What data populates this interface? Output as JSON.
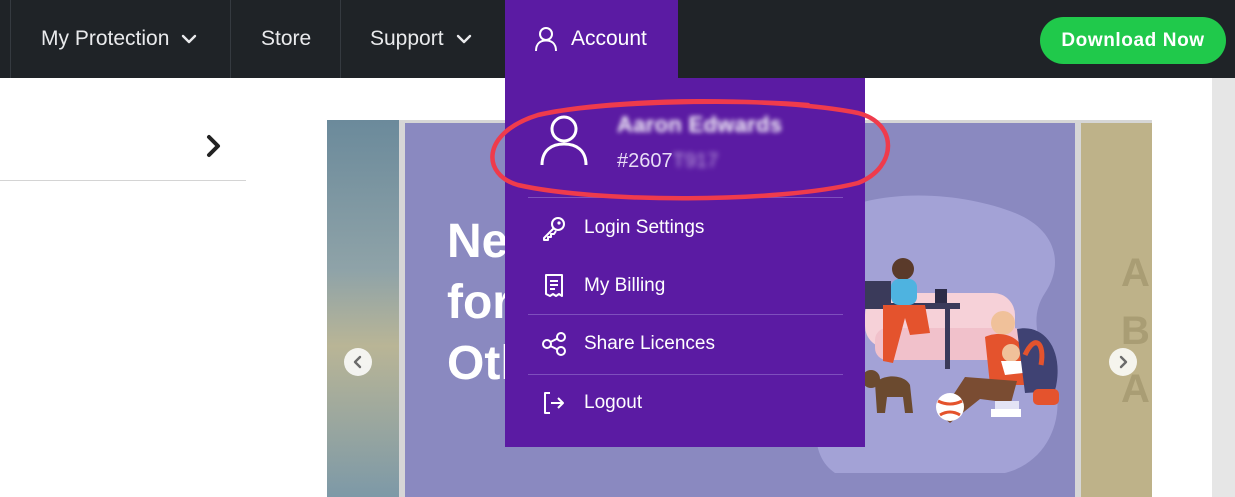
{
  "nav": {
    "items": [
      {
        "label": "My Protection",
        "has_dropdown": true
      },
      {
        "label": "Store",
        "has_dropdown": false
      },
      {
        "label": "Support",
        "has_dropdown": true
      }
    ],
    "account_label": "Account",
    "download_label": "Download Now"
  },
  "account_menu": {
    "user_name": "Aaron Edwards",
    "user_id_visible": "#2607",
    "user_id_hidden": "T917",
    "items": [
      {
        "label": "Login Settings",
        "icon": "key-icon"
      },
      {
        "label": "My Billing",
        "icon": "receipt-icon"
      },
      {
        "label": "Share Licences",
        "icon": "share-icon"
      },
      {
        "label": "Logout",
        "icon": "logout-icon"
      }
    ]
  },
  "carousel": {
    "hero_lines": [
      "Ne",
      "for",
      "Oth"
    ],
    "next_slide_letters": [
      "A",
      "B",
      "A"
    ]
  },
  "colors": {
    "nav_bg": "#1f2327",
    "account_purple": "#5b1ba3",
    "download_green": "#20c94b",
    "highlight_red": "#ef3b4c"
  }
}
